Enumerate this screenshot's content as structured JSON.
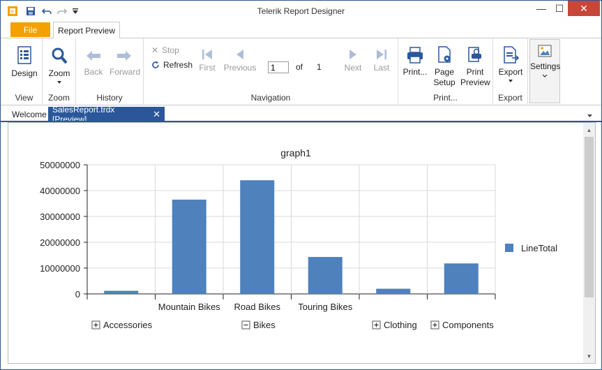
{
  "window": {
    "title": "Telerik Report Designer"
  },
  "window_controls": {
    "minimize": "—",
    "maximize": "☐",
    "close": "✕"
  },
  "ribbon_tabs": {
    "file": "File",
    "report_preview": "Report Preview"
  },
  "ribbon": {
    "view": {
      "group_label": "View",
      "design": "Design"
    },
    "zoom": {
      "group_label": "Zoom",
      "zoom": "Zoom"
    },
    "history": {
      "group_label": "History",
      "back": "Back",
      "forward": "Forward"
    },
    "navigation": {
      "group_label": "Navigation",
      "stop": "Stop",
      "refresh": "Refresh",
      "first": "First",
      "previous": "Previous",
      "page_value": "1",
      "of_label": "of",
      "total_pages": "1",
      "next": "Next",
      "last": "Last"
    },
    "print": {
      "group_label": "Print...",
      "print": "Print...",
      "page_setup_1": "Page",
      "page_setup_2": "Setup",
      "print_preview_1": "Print",
      "print_preview_2": "Preview"
    },
    "export": {
      "group_label": "Export",
      "export": "Export"
    },
    "settings": {
      "settings": "Settings"
    }
  },
  "doc_tabs": {
    "welcome": "Welcome",
    "active": "SalesReport.trdx [Preview]"
  },
  "colors": {
    "bar": "#4f81bd",
    "accent": "#2b579a",
    "file_tab": "#f2a100"
  },
  "chart_data": {
    "type": "bar",
    "title": "graph1",
    "categories": [
      "Accessories",
      "Mountain Bikes",
      "Road Bikes",
      "Touring Bikes",
      "Clothing",
      "Components"
    ],
    "category_labels_shown": [
      "",
      "Mountain Bikes",
      "Road Bikes",
      "Touring Bikes",
      "",
      ""
    ],
    "series": [
      {
        "name": "LineTotal",
        "values": [
          1200000,
          36500000,
          44000000,
          14300000,
          2000000,
          11800000
        ]
      }
    ],
    "yticks": [
      "0",
      "10000000",
      "20000000",
      "30000000",
      "40000000",
      "50000000"
    ],
    "ylim": [
      0,
      50000000
    ],
    "grid": true,
    "legend": "right",
    "groups": [
      {
        "sign": "+",
        "label": "Accessories"
      },
      {
        "sign": "−",
        "label": "Bikes"
      },
      {
        "sign": "+",
        "label": "Clothing"
      },
      {
        "sign": "+",
        "label": "Components"
      }
    ]
  }
}
